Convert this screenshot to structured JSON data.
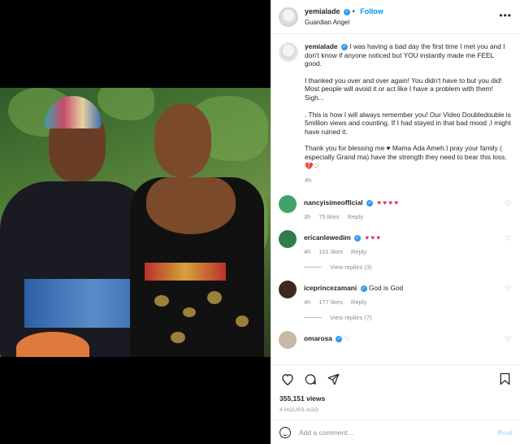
{
  "post": {
    "username": "yemialade",
    "follow_label": "Follow",
    "location": "Guardian Angel",
    "more_label": "•••"
  },
  "caption": {
    "username": "yemialade",
    "paragraphs": [
      "I was having a bad day the first time I met you and I don't know if anyone noticed but YOU instantly made me FEEL good.",
      "I thanked you over and over again! You didn't have to but you did! Most people will avoid it or act like I have a problem with them! Sigh...",
      ". This is how I will always remember you! Our Video Doubledouble is 5million views and counting. If I had stayed in that bad mood ,I might have ruined it.",
      "Thank you for blessing me ♥ Mama Ada Ameh.I pray your family ( especially Grand ma) have the strength they need to bear this loss. 💔♡"
    ],
    "time": "4h"
  },
  "comments": [
    {
      "username": "nancyisimeofficial",
      "text": "♥ ♥ ♥ ♥",
      "time": "3h",
      "likes": "75 likes",
      "reply": "Reply",
      "avatar_color": "#3fa36b"
    },
    {
      "username": "ericanlewedim",
      "text": "♥ ♥ ♥",
      "time": "4h",
      "likes": "101 likes",
      "reply": "Reply",
      "view_replies": "View replies (3)",
      "avatar_color": "#2e7d4a"
    },
    {
      "username": "iceprincezamani",
      "text": "God is God",
      "time": "4h",
      "likes": "177 likes",
      "reply": "Reply",
      "view_replies": "View replies (7)",
      "avatar_color": "#3b2a22"
    },
    {
      "username": "omarosa",
      "text": "♡",
      "avatar_color": "#c9b7a8"
    }
  ],
  "actions": {
    "views": "355,151 views",
    "posted": "4 HOURS AGO",
    "comment_placeholder": "Add a comment...",
    "post_label": "Post"
  },
  "icons": [
    "more-icon",
    "verified-icon",
    "heart-icon",
    "comment-icon",
    "share-icon",
    "bookmark-icon",
    "emoji-icon"
  ]
}
